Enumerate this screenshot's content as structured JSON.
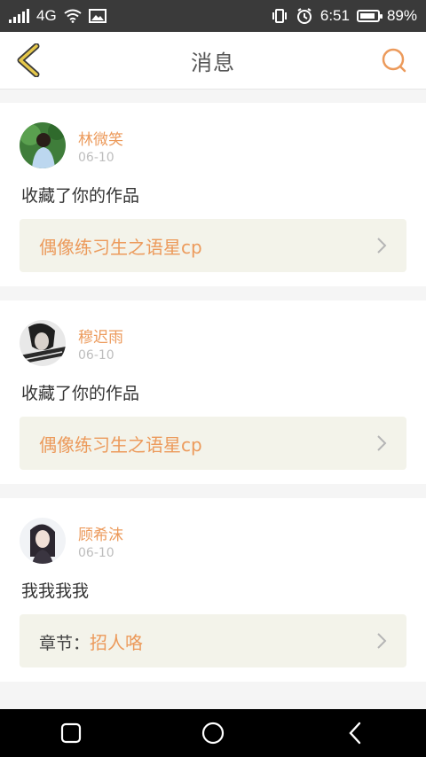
{
  "status_bar": {
    "network": "4G",
    "time": "6:51",
    "battery": "89%",
    "battery_level": 0.89
  },
  "header": {
    "title": "消息"
  },
  "messages": [
    {
      "user": "林微笑",
      "date": "06-10",
      "text": "收藏了你的作品",
      "link_prefix": "",
      "link_title": "偶像练习生之语星cp"
    },
    {
      "user": "穆迟雨",
      "date": "06-10",
      "text": "收藏了你的作品",
      "link_prefix": "",
      "link_title": "偶像练习生之语星cp"
    },
    {
      "user": "顾希沫",
      "date": "06-10",
      "text": "我我我我",
      "link_prefix": "章节：",
      "link_title": "招人咯"
    }
  ],
  "colors": {
    "accent": "#ec9a5b",
    "back_icon": "#e6c84a",
    "link_bg": "#f3f3ea"
  }
}
